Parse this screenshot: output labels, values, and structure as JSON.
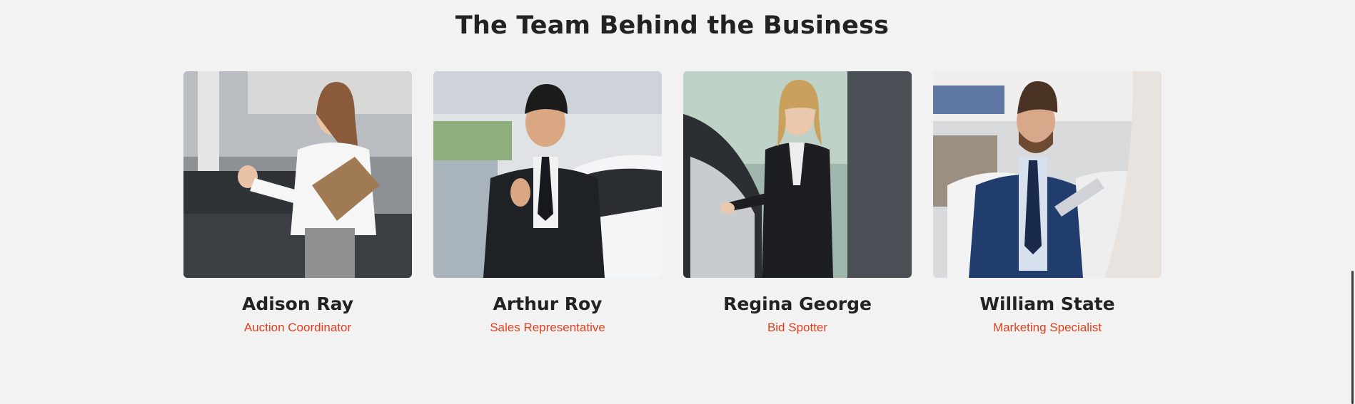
{
  "section": {
    "title": "The Team Behind the Business"
  },
  "team": [
    {
      "name": "Adison Ray",
      "role": "Auction Coordinator",
      "photo_icon": "woman-with-clipboard-photo"
    },
    {
      "name": "Arthur Roy",
      "role": "Sales Representative",
      "photo_icon": "man-thumbs-up-photo"
    },
    {
      "name": "Regina George",
      "role": "Bid Spotter",
      "photo_icon": "woman-opening-car-door-photo"
    },
    {
      "name": "William State",
      "role": "Marketing Specialist",
      "photo_icon": "man-with-tablet-photo"
    }
  ],
  "colors": {
    "accent": "#e0401f",
    "heading": "#222222",
    "background": "#f2f2f2"
  }
}
